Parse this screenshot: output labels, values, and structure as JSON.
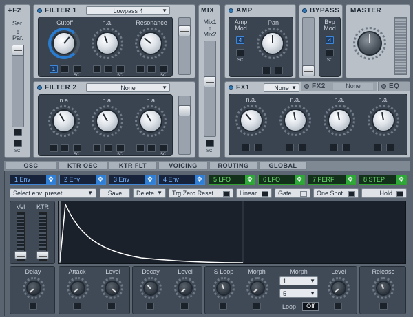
{
  "f2": {
    "title": "F2",
    "ser": "Ser.",
    "par": "Par.",
    "sc": "SC"
  },
  "filter1": {
    "title": "FILTER 1",
    "type": "Lowpass 4",
    "knobs": [
      "Cutoff",
      "n.a.",
      "Resonance"
    ],
    "value1": "1",
    "sc": "SC"
  },
  "filter2": {
    "title": "FILTER 2",
    "type": "None",
    "knobs": [
      "n.a.",
      "n.a.",
      "n.a."
    ],
    "sc": "SC"
  },
  "mix": {
    "title": "MIX",
    "top": "Mix1",
    "bottom": "Mix2",
    "sc": "SC"
  },
  "amp": {
    "title": "AMP",
    "amp_mod": "Amp Mod",
    "amp_val": "4",
    "sc": "SC",
    "pan": "Pan"
  },
  "bypass": {
    "title": "BYPASS",
    "byp_mod": "Byp Mod",
    "val": "4",
    "sc": "SC"
  },
  "master": {
    "title": "MASTER"
  },
  "fx": {
    "fx1": "FX1",
    "fx1_type": "None",
    "fx2": "FX2",
    "fx2_type": "None",
    "eq": "EQ",
    "knobs": [
      "n.a.",
      "n.a.",
      "n.a.",
      "n.a."
    ]
  },
  "tabs": [
    "OSC",
    "KTR OSC",
    "KTR FLT",
    "VOICING",
    "ROUTING",
    "GLOBAL"
  ],
  "envs": [
    "1 Env",
    "2 Env",
    "3 Env",
    "4 Env",
    "5 LFO",
    "6 LFO",
    "7 PERF",
    "8 STEP"
  ],
  "toolbar": {
    "preset": "Select env. preset",
    "save": "Save",
    "delete": "Delete",
    "trg": "Trg Zero Reset",
    "linear": "Linear",
    "gate": "Gate",
    "oneshot": "One Shot",
    "hold": "Hold"
  },
  "env_sliders": {
    "vel": "Vel",
    "ktr": "KTR"
  },
  "env_params": {
    "delay": "Delay",
    "attack": "Attack",
    "level1": "Level",
    "decay": "Decay",
    "level2": "Level",
    "sloop": "S Loop",
    "morph": "Morph",
    "morph2": "Morph",
    "morph_opt1": "1",
    "morph_opt2": "5",
    "loop": "Loop",
    "loop_val": "Off",
    "level3": "Level",
    "release": "Release"
  }
}
